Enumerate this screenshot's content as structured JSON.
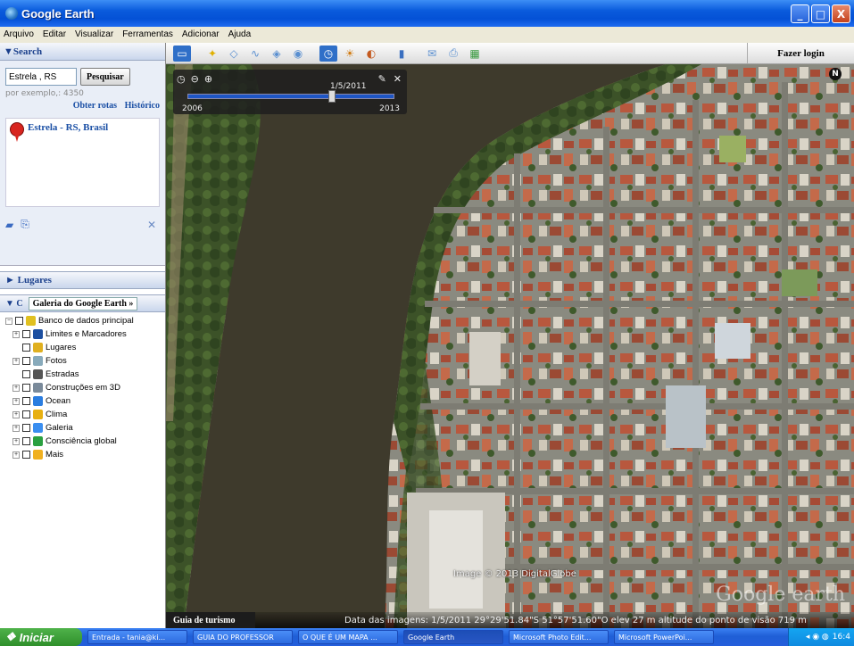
{
  "window": {
    "title": "Google Earth",
    "btn_minimize": "_",
    "btn_maximize": "□",
    "btn_close": "X"
  },
  "menu": [
    "Arquivo",
    "Editar",
    "Visualizar",
    "Ferramentas",
    "Adicionar",
    "Ajuda"
  ],
  "toolbar": {
    "login_label": "Fazer login"
  },
  "search": {
    "header": "▼Search",
    "query": "Estrela , RS",
    "button_label": "Pesquisar",
    "hint": "por exemplo,: 4350",
    "link_routes": "Obter rotas",
    "link_history": "Histórico",
    "result": "Estrela - RS, Brasil",
    "close_symbol": "✕"
  },
  "places": {
    "header": "► Lugares"
  },
  "layers": {
    "header": "▼ C",
    "gallery_button": "Galeria do Google Earth »",
    "items": [
      {
        "label": "Banco de dados principal",
        "color": "#e0c020"
      },
      {
        "label": "Limites e Marcadores",
        "color": "#1c4fa0"
      },
      {
        "label": "Lugares",
        "color": "#e0b020"
      },
      {
        "label": "Fotos",
        "color": "#8ab"
      },
      {
        "label": "Estradas",
        "color": "#555"
      },
      {
        "label": "Construções em 3D",
        "color": "#7a8a9a"
      },
      {
        "label": "Ocean",
        "color": "#2a7de0"
      },
      {
        "label": "Clima",
        "color": "#e8b010"
      },
      {
        "label": "Galeria",
        "color": "#3a8ef0"
      },
      {
        "label": "Consciência global",
        "color": "#2aa040"
      },
      {
        "label": "Mais",
        "color": "#f0b020"
      }
    ]
  },
  "map": {
    "time_date": "1/5/2011",
    "time_start": "2006",
    "time_end": "2013",
    "compass": "N",
    "credit": "Image © 2013 DigitalGlobe",
    "watermark": "Google earth",
    "tour_label": "Guia de turismo",
    "status": "Data das imagens: 1/5/2011    29°29'51.84\"S   51°57'51.60\"O   elev   27 m   altitude do ponto de visão  719 m"
  },
  "taskbar": {
    "start_label": "Iniciar",
    "tasks": [
      "Entrada - tania@ki...",
      "GUIA DO PROFESSOR",
      "O QUE É UM MAPA ...",
      "Google Earth",
      "Microsoft Photo Edit...",
      "Microsoft PowerPoi..."
    ],
    "clock": "16:4"
  }
}
